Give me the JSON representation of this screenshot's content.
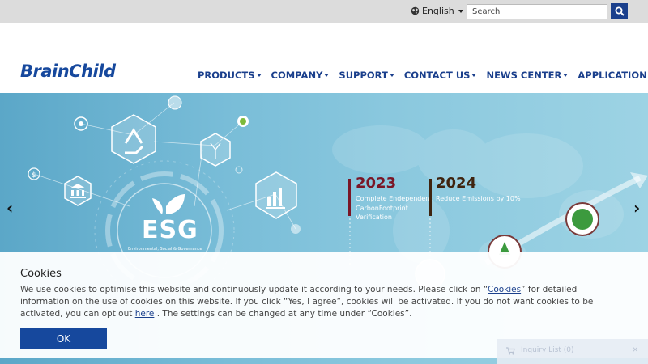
{
  "topbar": {
    "language": "English",
    "search_placeholder": "Search"
  },
  "header": {
    "logo": "BrainChild",
    "nav": [
      {
        "label": "PRODUCTS"
      },
      {
        "label": "COMPANY"
      },
      {
        "label": "SUPPORT"
      },
      {
        "label": "CONTACT US"
      },
      {
        "label": "NEWS CENTER"
      },
      {
        "label": "APPLICATION"
      }
    ]
  },
  "hero": {
    "esg_title": "ESG",
    "esg_subtitle": "Environmental, Social & Governance",
    "milestones": [
      {
        "year": "2023",
        "text": "Complete Endependent CarbonFootprint Verification"
      },
      {
        "year": "2024",
        "text": "Reduce Emissions by 10%"
      }
    ],
    "prev_arrow": "‹",
    "next_arrow": "›"
  },
  "cookie": {
    "title": "Cookies",
    "text_before_link": "We use cookies to optimise this website and continuously update it according to your needs. Please click on “",
    "link_cookies": "Cookies",
    "text_middle": "” for detailed information on the use of cookies on this website. If you click “Yes, I agree”, cookies will be activated. If you do not want cookies to be activated, you can opt out ",
    "link_here": "here",
    "text_after": " . The settings can be changed at any time under “Cookies”.",
    "ok_label": "OK"
  },
  "inquiry": {
    "label": "Inquiry List (0)",
    "close": "×"
  },
  "colors": {
    "brand": "#16489d",
    "nav": "#1a3f8c",
    "hero_start": "#5ba7c8",
    "hero_end": "#9dd3e4"
  }
}
